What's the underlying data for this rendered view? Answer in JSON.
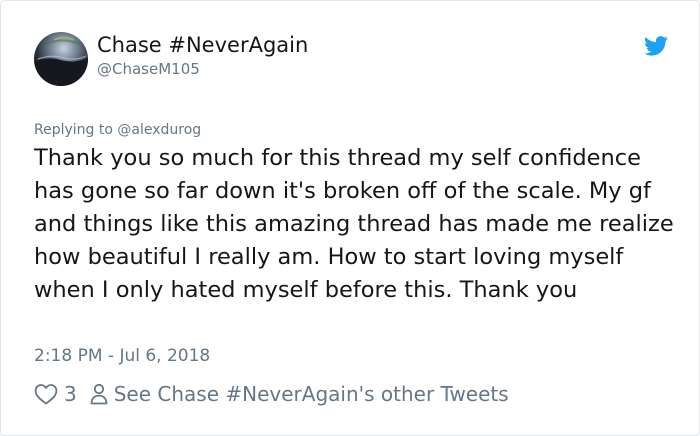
{
  "tweet": {
    "display_name": "Chase #NeverAgain",
    "handle": "@ChaseM105",
    "reply_to": "Replying to @alexdurog",
    "text": "Thank you so much for this thread my self confidence has gone so far down it's broken off of the scale. My gf and things like this amazing thread has made me realize how beautiful I really am. How to start loving myself when I only hated myself before this. Thank you",
    "timestamp": "2:18 PM - Jul 6, 2018",
    "likes": "3",
    "other_tweets_link": "See Chase #NeverAgain's other Tweets"
  },
  "icons": {
    "brand": "twitter-bird-icon",
    "like": "heart-icon",
    "profile": "person-icon"
  },
  "colors": {
    "brand_blue": "#1da1f2",
    "text_primary": "#14171a",
    "text_secondary": "#657786",
    "border": "#e1e8ed"
  }
}
